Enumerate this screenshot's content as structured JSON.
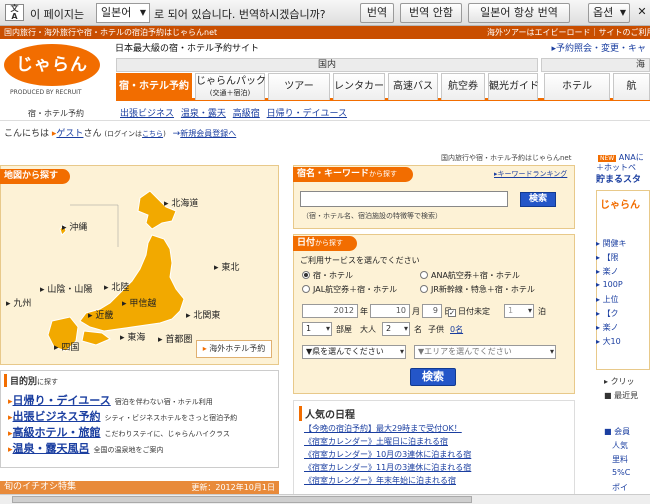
{
  "translate_bar": {
    "text1": "이 페이지는",
    "lang": "일본어",
    "text2": "로 되어 있습니다. 번역하시겠습니까?",
    "translate": "번역",
    "no_translate": "번역 안함",
    "always": "일본어 항상 번역",
    "options": "옵션"
  },
  "strip": {
    "left": "国内旅行・海外旅行や宿・ホテルの宿泊予約はじゃらんnet",
    "right": "海外ツアーはエイビーロード｜サイトのご利用"
  },
  "header": {
    "logo": "じゃらん",
    "powered": "PRODUCED BY RECRUIT",
    "tagline": "日本最大級の宿・ホテル予約サイト",
    "right_links": "予約照会・変更・キャ",
    "group_domestic": "国内",
    "group_overseas": "海",
    "tabs": [
      "宿・ホテル予約",
      "じゃらんパック",
      "ツアー",
      "レンタカー",
      "高速バス",
      "航空券",
      "観光ガイド",
      "ホテル",
      "航"
    ],
    "pack_sub": "(交通＋宿泊)"
  },
  "subnav": {
    "label": "宿・ホテル予約",
    "links": [
      "出張ビジネス",
      "温泉・露天",
      "高級宿",
      "日帰り・デイユース"
    ]
  },
  "greeting": {
    "hello": "こんにちは",
    "guest": "ゲスト",
    "san": "さん",
    "login_pre": "(ログインは",
    "login": "こちら",
    "login_post": ")",
    "register": "新規会員登録へ"
  },
  "map": {
    "title": "地図から探す",
    "regions": [
      "北海道",
      "沖縄",
      "東北",
      "九州",
      "山陰・山陽",
      "北陸",
      "甲信越",
      "北関東",
      "近畿",
      "東海",
      "首都圏",
      "四国"
    ],
    "overseas": "海外ホテル予約"
  },
  "purpose": {
    "title": "目的別",
    "title_suffix": "に探す",
    "items": [
      {
        "name": "日帰り・デイユース",
        "desc": "宿泊を伴わない宿・ホテル利用"
      },
      {
        "name": "出張ビジネス予約",
        "desc": "シティ・ビジネスホテルをさっと宿泊予約"
      },
      {
        "name": "高級ホテル・旅館",
        "desc": "こだわりステイに、じゃらんハイクラス"
      },
      {
        "name": "温泉・露天風呂",
        "desc": "全国の温泉地をご案内"
      }
    ],
    "bottom": "旬のイチオシ特集",
    "updated": "更新：2012年10月1日"
  },
  "keyword": {
    "site_title": "国内旅行や宿・ホテル予約はじゃらんnet",
    "title": "宿名・キーワード",
    "title_suffix": "から探す",
    "rank": "キーワードランキング",
    "value": "",
    "search": "検索",
    "hint": "（宿・ホテル名、宿泊施設の特徴等で検索）"
  },
  "date_search": {
    "title": "日付",
    "title_suffix": "から探す",
    "service_label": "ご利用サービスを選んでください",
    "services": [
      "宿・ホテル",
      "ANA航空券＋宿・ホテル",
      "JAL航空券＋宿・ホテル",
      "JR新幹線・特急＋宿・ホテル"
    ],
    "year": "2012",
    "year_unit": "年",
    "month": "10",
    "month_unit": "月",
    "day": "9",
    "day_unit": "日",
    "undecided": "日付未定",
    "nights": "1",
    "nights_unit": "泊",
    "rooms": "1",
    "rooms_unit": "部屋",
    "adult_label": "大人",
    "adults": "2",
    "adult_unit": "名",
    "child_label": "子供",
    "child": "0名",
    "pref": "▼県を選んでください",
    "area": "▼エリアを選んでください",
    "search": "検索"
  },
  "popular": {
    "title": "人気の日程",
    "items": [
      "【今晩の宿泊予約】最大29時まで受付OK！",
      "《宿室カレンダー》土曜日に泊まれる宿",
      "《宿室カレンダー》10月の3連休に泊まれる宿",
      "《宿室カレンダー》11月の3連休に泊まれる宿",
      "《宿室カレンダー》年末年始に泊まれる宿"
    ]
  },
  "right": {
    "ana": "ANAに",
    "hotpepper": "ホットペ",
    "notes": "貯まるスタ",
    "logo": "じゃらん",
    "lines": [
      "関健キ",
      "【限",
      "楽ノ",
      "100P",
      "上位",
      "【ク",
      "楽ノ",
      "大10"
    ],
    "click": "クリッ",
    "recent": "最近見",
    "member": "会員",
    "m1": "人気",
    "m2": "里料",
    "m3": "5%C",
    "m4": "ポイ"
  }
}
